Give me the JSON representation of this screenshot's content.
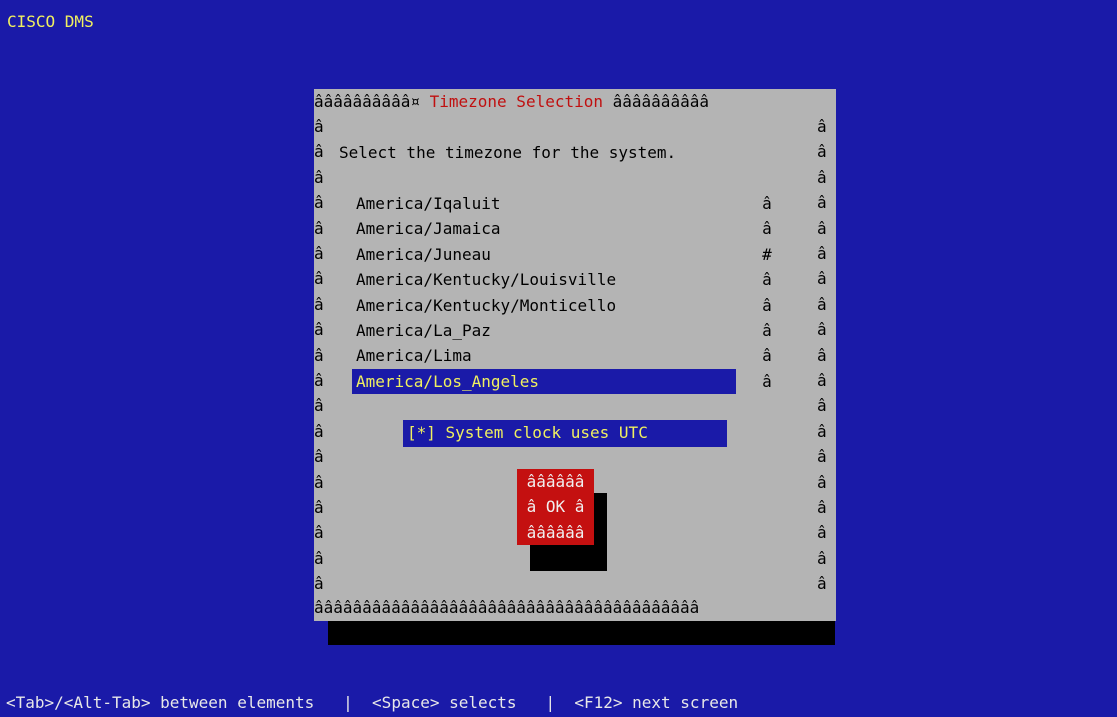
{
  "app": {
    "title": "CISCO DMS"
  },
  "dialog": {
    "border_top_left": "ââââââââââ¤",
    "border_top_right": "ââââââââââ",
    "title": "Timezone Selection",
    "border_bottom": "ââââââââââââââââââââââââââââââââââââââââ",
    "side_glyph": "â",
    "prompt": "Select the timezone for the system."
  },
  "timezone_list": {
    "items": [
      {
        "label": "America/Iqaluit",
        "scroll": "â"
      },
      {
        "label": "America/Jamaica",
        "scroll": "â"
      },
      {
        "label": "America/Juneau",
        "scroll": "#"
      },
      {
        "label": "America/Kentucky/Louisville",
        "scroll": "â"
      },
      {
        "label": "America/Kentucky/Monticello",
        "scroll": "â"
      },
      {
        "label": "America/La_Paz",
        "scroll": "â"
      },
      {
        "label": "America/Lima",
        "scroll": "â"
      },
      {
        "label": "America/Los_Angeles",
        "scroll": "â"
      }
    ],
    "selected_index": 7
  },
  "utc_checkbox": {
    "label": "[*] System clock uses UTC"
  },
  "ok_button": {
    "top": "ââââââ",
    "label": "â OK â",
    "bottom": "ââââââ"
  },
  "help_bar": {
    "text": "<Tab>/<Alt-Tab> between elements   |  <Space> selects   |  <F12> next screen"
  },
  "colors": {
    "screen_background": "#1a1aa8",
    "dialog_background": "#b4b4b4",
    "title_text": "#c01010",
    "highlight_text": "#f0f060",
    "button_background": "#c41010"
  }
}
